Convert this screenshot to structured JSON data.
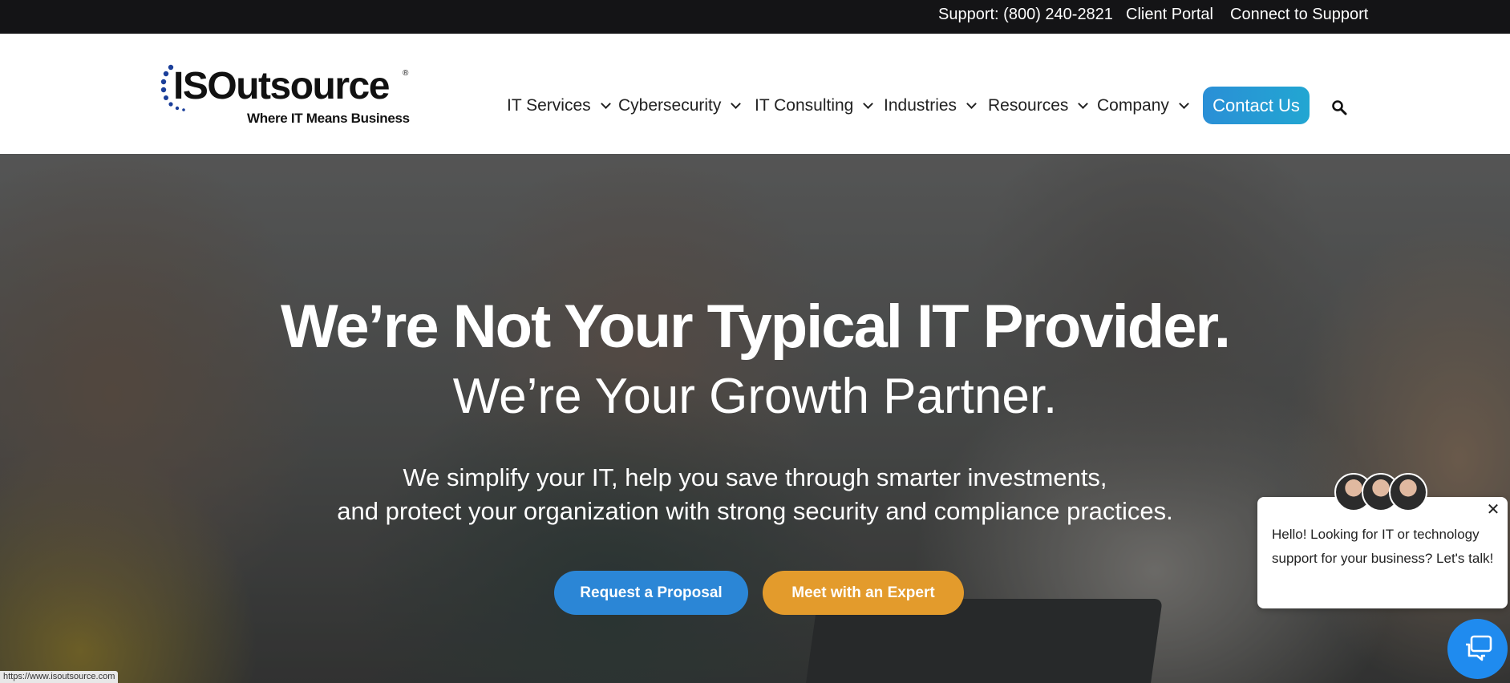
{
  "topbar": {
    "support": "Support: (800) 240-2821",
    "client_portal": "Client Portal",
    "connect_support": "Connect to Support"
  },
  "logo": {
    "name": "ISOutsource",
    "registered": "®",
    "tagline": "Where IT Means Business"
  },
  "nav": {
    "items": [
      {
        "label": "IT Services"
      },
      {
        "label": "Cybersecurity"
      },
      {
        "label": "IT Consulting"
      },
      {
        "label": "Industries"
      },
      {
        "label": "Resources"
      },
      {
        "label": "Company"
      }
    ],
    "contact_label": "Contact Us",
    "search_icon": "search-icon"
  },
  "hero": {
    "headline": "We’re Not Your Typical IT Provider.",
    "subheadline": "We’re Your Growth Partner.",
    "description_line1": "We simplify your IT, help you save through smarter investments,",
    "description_line2": "and protect your organization with strong security and compliance practices.",
    "primary_button": "Request a Proposal",
    "secondary_button": "Meet with an Expert"
  },
  "chat": {
    "message": "Hello! Looking for IT or technology support for your business? Let's talk!",
    "close_icon": "close-icon",
    "launcher_icon": "chat-icon"
  },
  "status_bar": {
    "url": "https://www.isoutsource.com"
  },
  "colors": {
    "topbar_bg": "#141416",
    "contact_button": "#2a8fd6",
    "proposal_button": "#2b86d6",
    "expert_button": "#e39b2c",
    "chat_launcher": "#1f8bef"
  }
}
